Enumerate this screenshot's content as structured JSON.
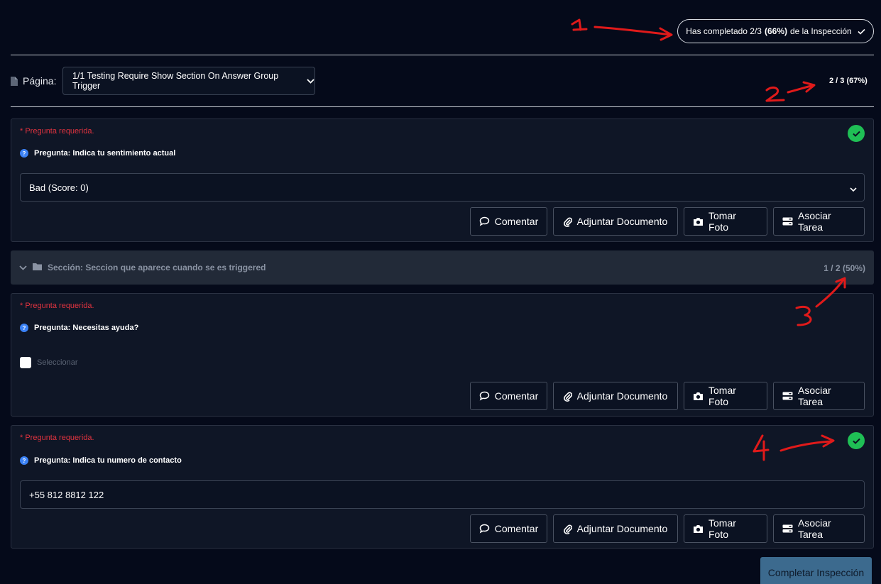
{
  "header": {
    "progress_prefix": "Has completado 2/3",
    "progress_percent": "(66%)",
    "progress_suffix": "de la Inspección"
  },
  "page_selector": {
    "label": "Página:",
    "selected": "1/1 Testing Require Show Section On Answer Group Trigger",
    "progress": "2 / 3 (67%)"
  },
  "actions": {
    "comment": "Comentar",
    "attach": "Adjuntar Documento",
    "photo": "Tomar Foto",
    "task": "Asociar Tarea"
  },
  "questions": [
    {
      "required": "* Pregunta requerida.",
      "title": "Pregunta: Indica tu sentimiento actual",
      "value": "Bad (Score: 0)",
      "answered": true
    },
    {
      "required": "* Pregunta requerida.",
      "title": "Pregunta: Necesitas ayuda?",
      "checkbox_label": "Seleccionar",
      "answered": false
    },
    {
      "required": "* Pregunta requerida.",
      "title": "Pregunta: Indica tu numero de contacto",
      "value": "+55 812 8812 122",
      "answered": true
    }
  ],
  "section": {
    "title": "Sección: Seccion que aparece cuando se es triggered",
    "progress": "1 / 2 (50%)"
  },
  "complete_button": "Completar Inspección",
  "colors": {
    "background": "#050a1a",
    "card": "#0f1626",
    "required": "#e0333f",
    "answered": "#1fbf55",
    "help": "#3b82f6",
    "annotation": "#e01a1a",
    "complete_button": "#3c6a8e"
  },
  "annotations": [
    "1",
    "2",
    "3",
    "4"
  ]
}
